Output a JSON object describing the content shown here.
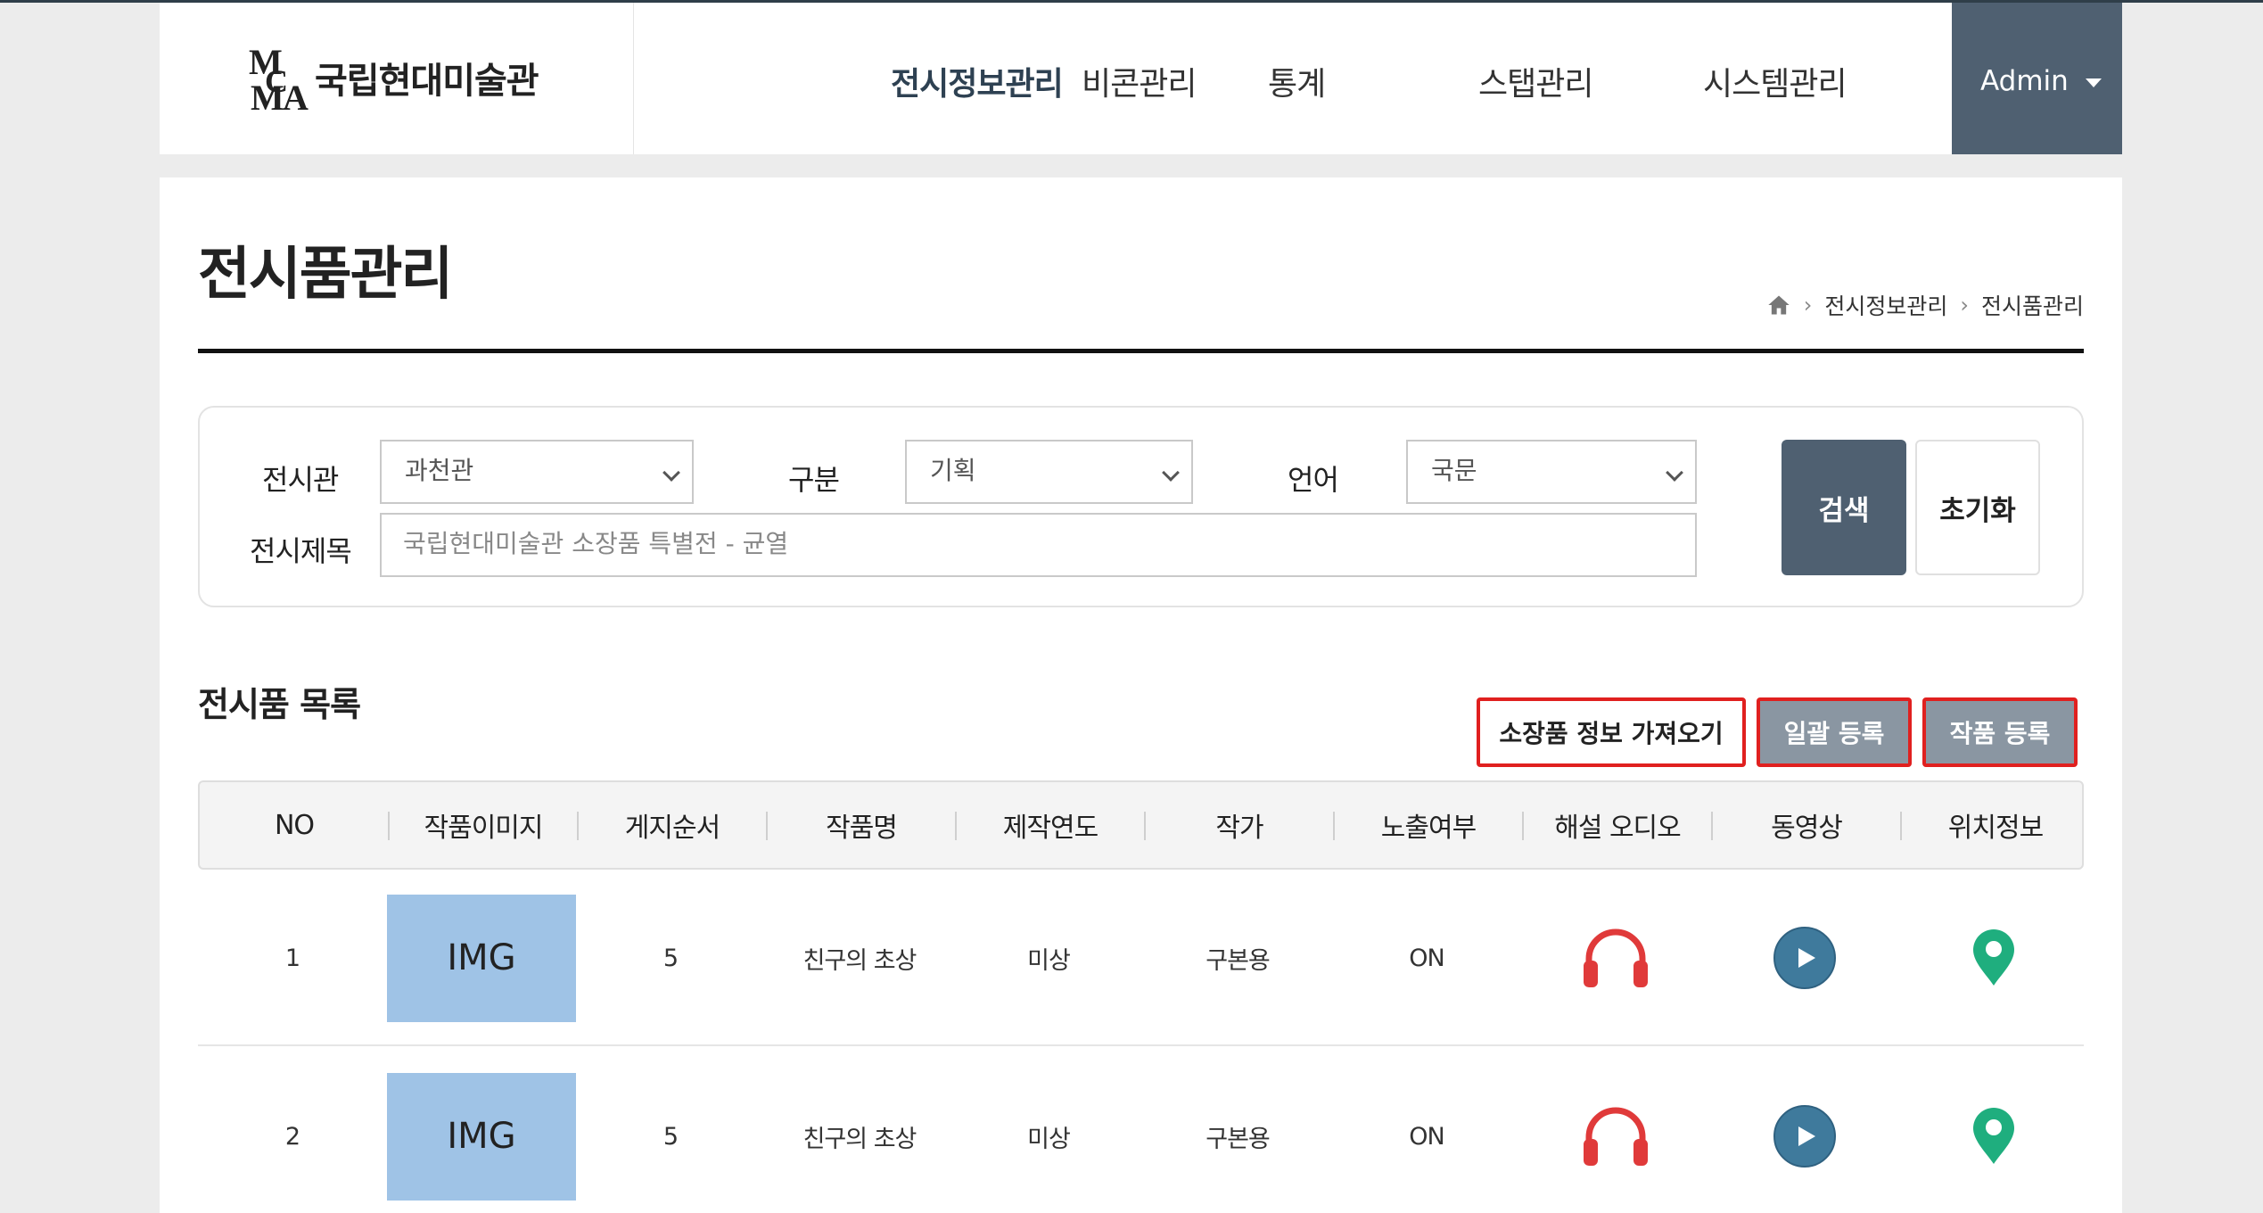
{
  "header": {
    "logo_text": "국립현대미술관",
    "nav": [
      "전시정보관리",
      "비콘관리",
      "통계",
      "스탭관리",
      "시스템관리"
    ],
    "admin_label": "Admin"
  },
  "page": {
    "title": "전시품관리",
    "breadcrumb": [
      "전시정보관리",
      "전시품관리"
    ]
  },
  "search": {
    "gallery_label": "전시관",
    "gallery_value": "과천관",
    "type_label": "구분",
    "type_value": "기획",
    "lang_label": "언어",
    "lang_value": "국문",
    "title_label": "전시제목",
    "title_placeholder": "국립현대미술관 소장품 특별전 - 균열",
    "search_button": "검색",
    "reset_button": "초기화"
  },
  "list": {
    "title": "전시품 목록",
    "import_button": "소장품 정보 가져오기",
    "bulk_button": "일괄 등록",
    "add_button": "작품 등록",
    "columns": [
      "NO",
      "작품이미지",
      "게지순서",
      "작품명",
      "제작연도",
      "작가",
      "노출여부",
      "해설 오디오",
      "동영상",
      "위치정보"
    ],
    "rows": [
      {
        "no": "1",
        "image": "IMG",
        "order": "5",
        "name": "친구의 초상",
        "year": "미상",
        "artist": "구본용",
        "visible": "ON"
      },
      {
        "no": "2",
        "image": "IMG",
        "order": "5",
        "name": "친구의 초상",
        "year": "미상",
        "artist": "구본용",
        "visible": "ON"
      }
    ]
  },
  "colors": {
    "accent": "#4f6071",
    "highlight": "#e0201f",
    "audio_icon": "#e03a3a",
    "video_icon": "#3f7a9c",
    "location_icon": "#1fae7e",
    "thumbnail": "#9fc3e6"
  },
  "icons": [
    "home-icon",
    "headphones-icon",
    "play-icon",
    "map-pin-icon",
    "caret-down-icon",
    "chevron-down-icon"
  ]
}
